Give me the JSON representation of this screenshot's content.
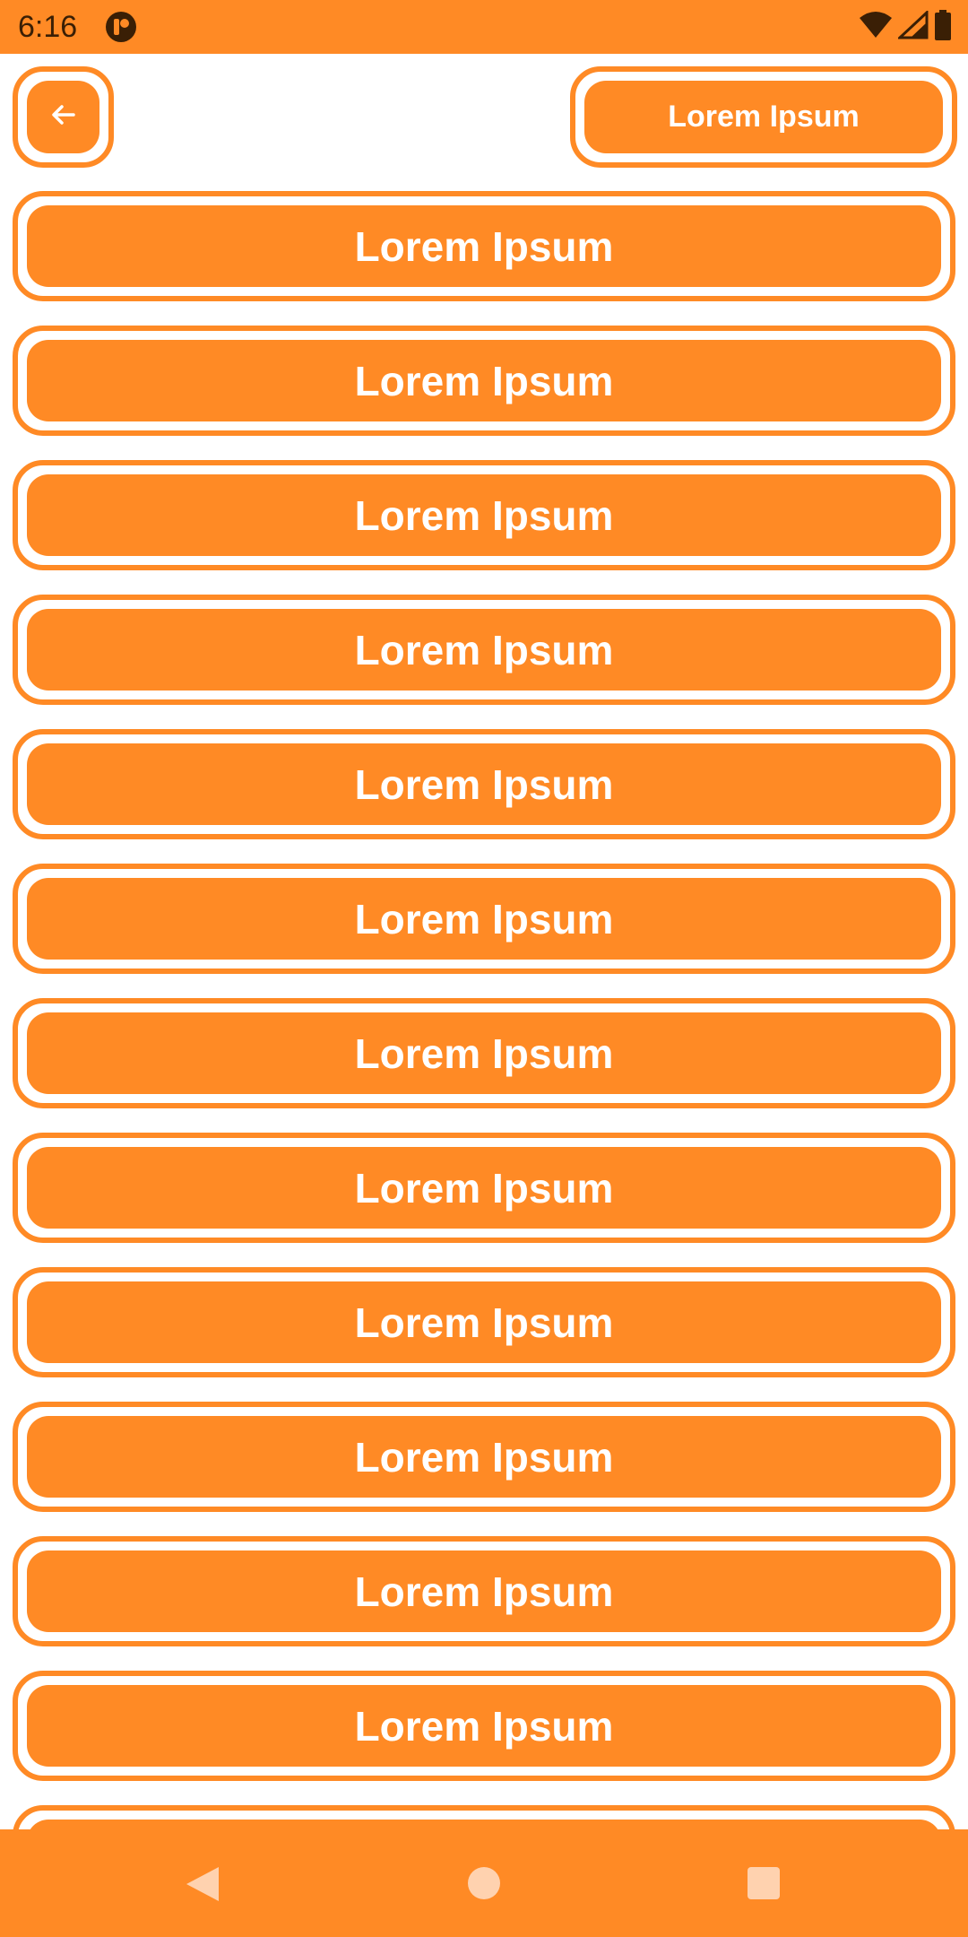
{
  "status_bar": {
    "time": "6:16",
    "icons": [
      "app-notification-icon",
      "wifi-icon",
      "signal-icon",
      "battery-icon"
    ]
  },
  "header": {
    "back_icon": "arrow-left-icon",
    "action_label": "Lorem Ipsum"
  },
  "list": {
    "items": [
      {
        "label": "Lorem Ipsum"
      },
      {
        "label": "Lorem Ipsum"
      },
      {
        "label": "Lorem Ipsum"
      },
      {
        "label": "Lorem Ipsum"
      },
      {
        "label": "Lorem Ipsum"
      },
      {
        "label": "Lorem Ipsum"
      },
      {
        "label": "Lorem Ipsum"
      },
      {
        "label": "Lorem Ipsum"
      },
      {
        "label": "Lorem Ipsum"
      },
      {
        "label": "Lorem Ipsum"
      },
      {
        "label": "Lorem Ipsum"
      },
      {
        "label": "Lorem Ipsum"
      },
      {
        "label": ""
      }
    ]
  },
  "nav_bar": {
    "icons": [
      "nav-back-icon",
      "nav-home-icon",
      "nav-recents-icon"
    ]
  },
  "colors": {
    "accent": "#FF8A25",
    "on_accent": "#FFFFFF",
    "nav_icon": "#FFD2AF",
    "status_text": "#3A1F05"
  }
}
